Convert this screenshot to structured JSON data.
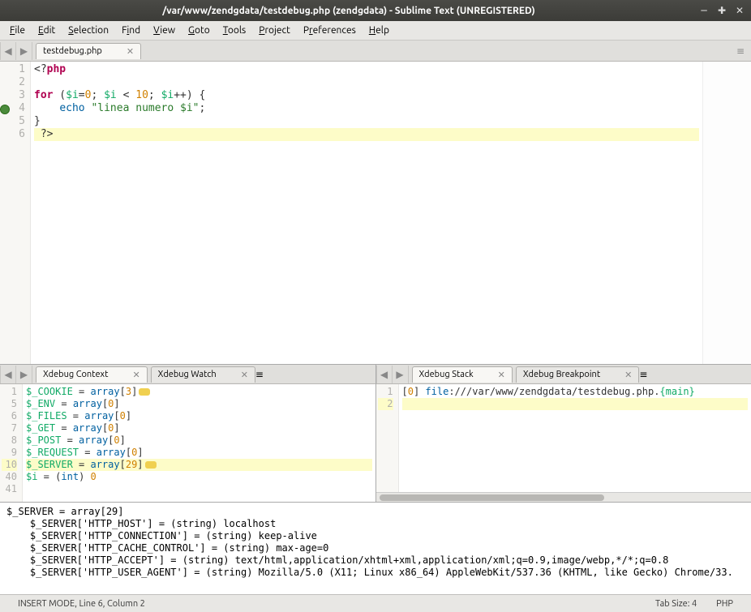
{
  "window": {
    "title": "/var/www/zendgdata/testdebug.php (zendgdata) - Sublime Text (UNREGISTERED)"
  },
  "menu": {
    "items": [
      "File",
      "Edit",
      "Selection",
      "Find",
      "View",
      "Goto",
      "Tools",
      "Project",
      "Preferences",
      "Help"
    ]
  },
  "main_tab": {
    "label": "testdebug.php"
  },
  "editor": {
    "lines": [
      {
        "n": 1,
        "tokens": [
          [
            "op",
            "<?"
          ],
          [
            "kw",
            "php"
          ]
        ]
      },
      {
        "n": 2,
        "tokens": []
      },
      {
        "n": 3,
        "tokens": [
          [
            "kw",
            "for"
          ],
          [
            "op",
            " ("
          ],
          [
            "var",
            "$i"
          ],
          [
            "op",
            "="
          ],
          [
            "num",
            "0"
          ],
          [
            "op",
            "; "
          ],
          [
            "var",
            "$i"
          ],
          [
            "op",
            " "
          ],
          [
            "op",
            "<"
          ],
          [
            "op",
            " "
          ],
          [
            "num",
            "10"
          ],
          [
            "op",
            "; "
          ],
          [
            "var",
            "$i"
          ],
          [
            "op",
            "++"
          ],
          [
            "op",
            ") {"
          ]
        ]
      },
      {
        "n": 4,
        "bp": true,
        "tokens": [
          [
            "op",
            "    "
          ],
          [
            "fn",
            "echo"
          ],
          [
            "op",
            " "
          ],
          [
            "str",
            "\"linea numero $i\""
          ],
          [
            "op",
            ";"
          ]
        ]
      },
      {
        "n": 5,
        "tokens": [
          [
            "op",
            "}"
          ]
        ]
      },
      {
        "n": 6,
        "hl": true,
        "tokens": [
          [
            "op",
            " "
          ],
          [
            "op",
            "?>"
          ]
        ]
      }
    ]
  },
  "panel_left": {
    "tabs": [
      {
        "label": "Xdebug Context",
        "active": true
      },
      {
        "label": "Xdebug Watch",
        "active": false
      }
    ],
    "lines": [
      {
        "n": 1,
        "text_parts": [
          [
            "var",
            "$_COOKIE"
          ],
          [
            "op",
            " = "
          ],
          [
            "fn",
            "array"
          ],
          [
            "op",
            "["
          ],
          [
            "num",
            "3"
          ],
          [
            "op",
            "]"
          ]
        ],
        "badge": true
      },
      {
        "n": 5,
        "text_parts": [
          [
            "var",
            "$_ENV"
          ],
          [
            "op",
            " = "
          ],
          [
            "fn",
            "array"
          ],
          [
            "op",
            "["
          ],
          [
            "num",
            "0"
          ],
          [
            "op",
            "]"
          ]
        ]
      },
      {
        "n": 6,
        "text_parts": [
          [
            "var",
            "$_FILES"
          ],
          [
            "op",
            " = "
          ],
          [
            "fn",
            "array"
          ],
          [
            "op",
            "["
          ],
          [
            "num",
            "0"
          ],
          [
            "op",
            "]"
          ]
        ]
      },
      {
        "n": 7,
        "text_parts": [
          [
            "var",
            "$_GET"
          ],
          [
            "op",
            " = "
          ],
          [
            "fn",
            "array"
          ],
          [
            "op",
            "["
          ],
          [
            "num",
            "0"
          ],
          [
            "op",
            "]"
          ]
        ]
      },
      {
        "n": 8,
        "text_parts": [
          [
            "var",
            "$_POST"
          ],
          [
            "op",
            " = "
          ],
          [
            "fn",
            "array"
          ],
          [
            "op",
            "["
          ],
          [
            "num",
            "0"
          ],
          [
            "op",
            "]"
          ]
        ]
      },
      {
        "n": 9,
        "text_parts": [
          [
            "var",
            "$_REQUEST"
          ],
          [
            "op",
            " = "
          ],
          [
            "fn",
            "array"
          ],
          [
            "op",
            "["
          ],
          [
            "num",
            "0"
          ],
          [
            "op",
            "]"
          ]
        ]
      },
      {
        "n": 10,
        "hl": true,
        "text_parts": [
          [
            "var",
            "$_SERVER"
          ],
          [
            "op",
            " = "
          ],
          [
            "fn",
            "array"
          ],
          [
            "op",
            "["
          ],
          [
            "num",
            "29"
          ],
          [
            "op",
            "]"
          ]
        ],
        "badge": true
      },
      {
        "n": 40,
        "text_parts": [
          [
            "var",
            "$i"
          ],
          [
            "op",
            " = "
          ],
          [
            "op",
            "("
          ],
          [
            "fn",
            "int"
          ],
          [
            "op",
            ") "
          ],
          [
            "num",
            "0"
          ]
        ]
      },
      {
        "n": 41,
        "text_parts": []
      }
    ]
  },
  "panel_right": {
    "tabs": [
      {
        "label": "Xdebug Stack",
        "active": true
      },
      {
        "label": "Xdebug Breakpoint",
        "active": false
      }
    ],
    "lines": [
      {
        "n": 1,
        "text_parts": [
          [
            "op",
            "["
          ],
          [
            "num",
            "0"
          ],
          [
            "op",
            "] "
          ],
          [
            "fn",
            "file"
          ],
          [
            "op",
            ":///var/www/zendgdata/testdebug.php."
          ],
          [
            "var",
            "{main}"
          ]
        ]
      },
      {
        "n": 2,
        "hl": true,
        "text_parts": []
      }
    ]
  },
  "bottom": {
    "lines": [
      "$_SERVER = array[29]",
      "    $_SERVER['HTTP_HOST'] = (string) localhost",
      "    $_SERVER['HTTP_CONNECTION'] = (string) keep-alive",
      "    $_SERVER['HTTP_CACHE_CONTROL'] = (string) max-age=0",
      "    $_SERVER['HTTP_ACCEPT'] = (string) text/html,application/xhtml+xml,application/xml;q=0.9,image/webp,*/*;q=0.8",
      "    $_SERVER['HTTP_USER_AGENT'] = (string) Mozilla/5.0 (X11; Linux x86_64) AppleWebKit/537.36 (KHTML, like Gecko) Chrome/33."
    ]
  },
  "status": {
    "left": "INSERT MODE, Line 6, Column 2",
    "tab_size": "Tab Size: 4",
    "lang": "PHP"
  }
}
